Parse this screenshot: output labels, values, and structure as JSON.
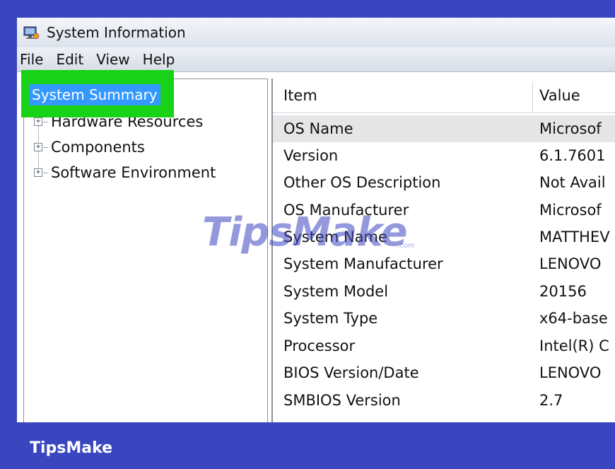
{
  "window": {
    "title": "System Information",
    "icon": "system-info-icon"
  },
  "menu": [
    "File",
    "Edit",
    "View",
    "Help"
  ],
  "tree": {
    "selected": "System Summary",
    "nodes": [
      {
        "label": "Hardware Resources",
        "expander": "+"
      },
      {
        "label": "Components",
        "expander": "+"
      },
      {
        "label": "Software Environment",
        "expander": "+"
      }
    ]
  },
  "table": {
    "columns": [
      "Item",
      "Value"
    ],
    "rows": [
      {
        "item": "OS Name",
        "value": "Microsof"
      },
      {
        "item": "Version",
        "value": "6.1.7601"
      },
      {
        "item": "Other OS Description",
        "value": "Not Avail"
      },
      {
        "item": "OS Manufacturer",
        "value": "Microsof"
      },
      {
        "item": "System Name",
        "value": "MATTHEV"
      },
      {
        "item": "System Manufacturer",
        "value": "LENOVO"
      },
      {
        "item": "System Model",
        "value": "20156"
      },
      {
        "item": "System Type",
        "value": "x64-base"
      },
      {
        "item": "Processor",
        "value": "Intel(R) C"
      },
      {
        "item": "BIOS Version/Date",
        "value": "LENOVO"
      },
      {
        "item": "SMBIOS Version",
        "value": "2.7"
      }
    ]
  },
  "watermark": {
    "brand": "TipsMake",
    "sub": ".com"
  },
  "footer": {
    "brand": "TipsMake"
  },
  "colors": {
    "background": "#3a46c0",
    "highlight": "#18d218",
    "selection": "#3399ff"
  }
}
